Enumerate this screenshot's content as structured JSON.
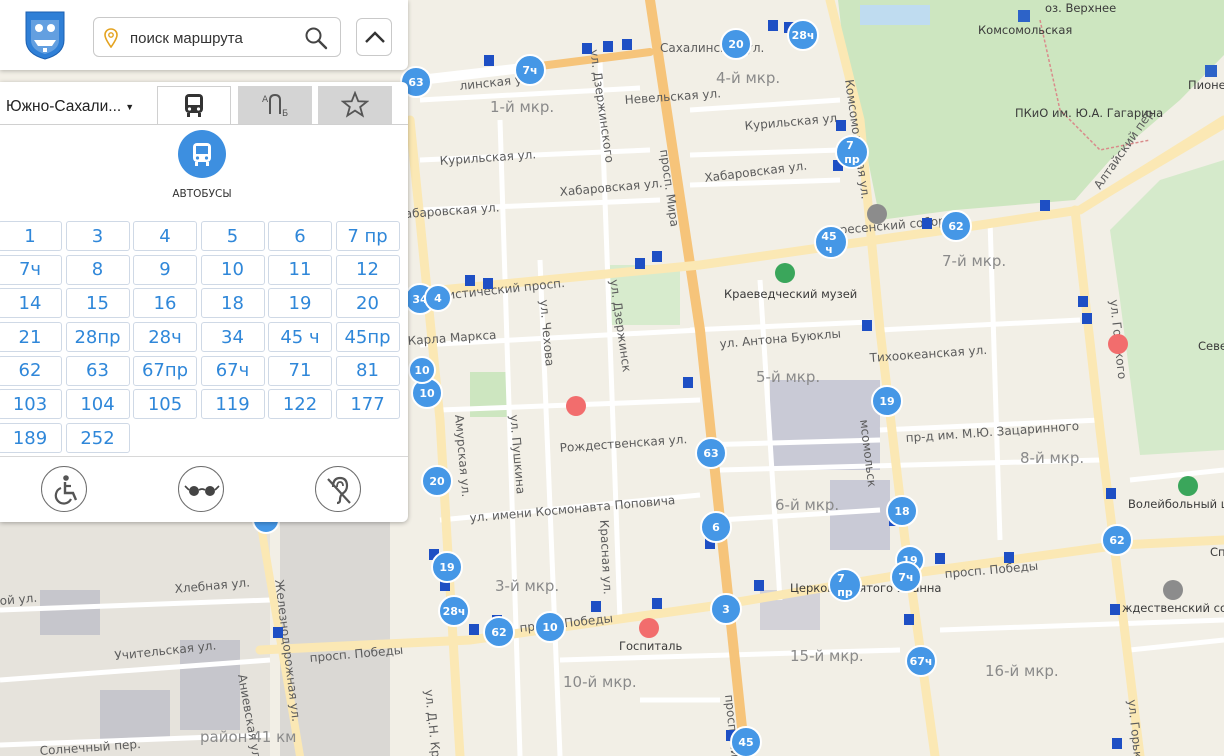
{
  "app": {
    "logo_name": "sakhalin-coat-of-arms"
  },
  "search": {
    "placeholder": "поиск маршрута",
    "value": ""
  },
  "panel": {
    "city": "Южно-Сахали...",
    "tabs": [
      "buses",
      "route-planner",
      "favorites"
    ],
    "active_tab": "buses",
    "mode_label": "АВТОБУСЫ",
    "routes": [
      "1",
      "3",
      "4",
      "5",
      "6",
      "7 пр",
      "7ч",
      "8",
      "9",
      "10",
      "11",
      "12",
      "14",
      "15",
      "16",
      "18",
      "19",
      "20",
      "21",
      "28пр",
      "28ч",
      "34",
      "45 ч",
      "45пр",
      "62",
      "63",
      "67пр",
      "67ч",
      "71",
      "81",
      "103",
      "104",
      "105",
      "119",
      "122",
      "177",
      "189",
      "252"
    ],
    "accessibility": [
      "wheelchair-icon",
      "low-vision-glasses-icon",
      "hearing-impaired-icon"
    ]
  },
  "colors": {
    "accent": "#3d8fe0",
    "route_text": "#2f87d9",
    "stop_marker": "#1e4fc4",
    "park": "#cde6c0",
    "major_road": "#f6c47a"
  },
  "map": {
    "streets": [
      "Сахалинская ул.",
      "линская ул.",
      "Невельская ул.",
      "Курильская ул.",
      "Хабаровская ул.",
      "Комсомольская ул.",
      "Алтайский пер.",
      "просп. Мира",
      "ул. Дзержинского",
      "нистический просп.",
      "Карла Маркса",
      "ул. Чехова",
      "ул. Антона Буюклы",
      "Тихоокеанская ул.",
      "Амурская ул.",
      "ул. Пушкина",
      "Рождественская ул.",
      "пр-д им. М.Ю. Зацаринного",
      "ул. имени Космонавта Поповича",
      "Красная ул.",
      "просп. Победы",
      "ул. Горького",
      "Хлебная ул.",
      "Учительская ул.",
      "Железнодорожная ул.",
      "Аниевская ул.",
      "Солнечный пер.",
      "ул. Д.Н. Крюк",
      "ресенский собор",
      "абаровская ул.",
      "ой ул.",
      "ул. Дзержинск",
      "мсомольск",
      "просп. Ми",
      "ул. Горько",
      "ул. Дзержинского"
    ],
    "districts": [
      "1-й мкр.",
      "4-й мкр.",
      "7-й мкр.",
      "5-й мкр.",
      "8-й мкр.",
      "6-й мкр.",
      "3-й мкр.",
      "15-й мкр.",
      "10-й мкр.",
      "16-й мкр.",
      "район 41 км"
    ],
    "pois": [
      "оз. Верхнее",
      "Комсомольская",
      "Пионе",
      "ПКиО им. Ю.А. Гагарина",
      "Краеведческий музей",
      "Госпиталь",
      "Волейбольный центр Сахалин",
      "Церковь Святого Иоанна",
      "ждественский собор",
      "Севе",
      "Спо",
      "Г"
    ],
    "route_markers": [
      "20",
      "28ч",
      "63",
      "7ч",
      "7 пр",
      "62",
      "45 ч",
      "34",
      "4",
      "10",
      "19",
      "20",
      "63",
      "6",
      "18",
      "3",
      "7 пр",
      "7ч",
      "62",
      "28ч",
      "62",
      "10",
      "67ч",
      "45",
      "10",
      "19",
      "18"
    ]
  }
}
